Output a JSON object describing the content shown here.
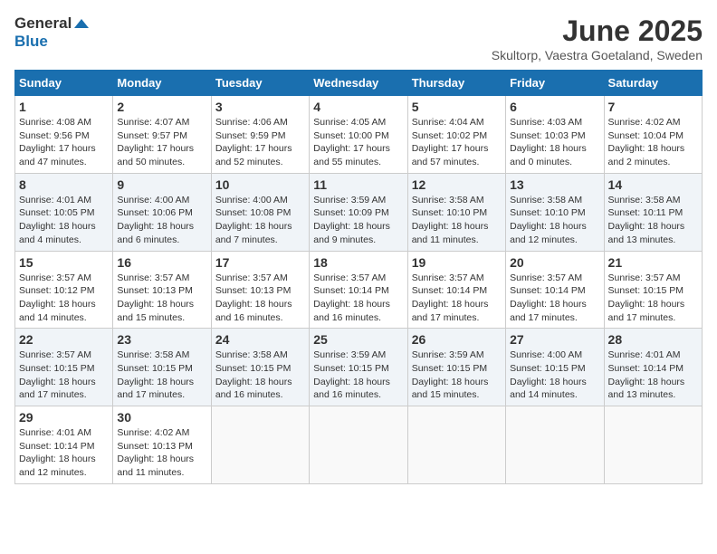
{
  "header": {
    "logo_general": "General",
    "logo_blue": "Blue",
    "month": "June 2025",
    "location": "Skultorp, Vaestra Goetaland, Sweden"
  },
  "weekdays": [
    "Sunday",
    "Monday",
    "Tuesday",
    "Wednesday",
    "Thursday",
    "Friday",
    "Saturday"
  ],
  "weeks": [
    [
      {
        "day": "1",
        "sunrise": "Sunrise: 4:08 AM",
        "sunset": "Sunset: 9:56 PM",
        "daylight": "Daylight: 17 hours and 47 minutes."
      },
      {
        "day": "2",
        "sunrise": "Sunrise: 4:07 AM",
        "sunset": "Sunset: 9:57 PM",
        "daylight": "Daylight: 17 hours and 50 minutes."
      },
      {
        "day": "3",
        "sunrise": "Sunrise: 4:06 AM",
        "sunset": "Sunset: 9:59 PM",
        "daylight": "Daylight: 17 hours and 52 minutes."
      },
      {
        "day": "4",
        "sunrise": "Sunrise: 4:05 AM",
        "sunset": "Sunset: 10:00 PM",
        "daylight": "Daylight: 17 hours and 55 minutes."
      },
      {
        "day": "5",
        "sunrise": "Sunrise: 4:04 AM",
        "sunset": "Sunset: 10:02 PM",
        "daylight": "Daylight: 17 hours and 57 minutes."
      },
      {
        "day": "6",
        "sunrise": "Sunrise: 4:03 AM",
        "sunset": "Sunset: 10:03 PM",
        "daylight": "Daylight: 18 hours and 0 minutes."
      },
      {
        "day": "7",
        "sunrise": "Sunrise: 4:02 AM",
        "sunset": "Sunset: 10:04 PM",
        "daylight": "Daylight: 18 hours and 2 minutes."
      }
    ],
    [
      {
        "day": "8",
        "sunrise": "Sunrise: 4:01 AM",
        "sunset": "Sunset: 10:05 PM",
        "daylight": "Daylight: 18 hours and 4 minutes."
      },
      {
        "day": "9",
        "sunrise": "Sunrise: 4:00 AM",
        "sunset": "Sunset: 10:06 PM",
        "daylight": "Daylight: 18 hours and 6 minutes."
      },
      {
        "day": "10",
        "sunrise": "Sunrise: 4:00 AM",
        "sunset": "Sunset: 10:08 PM",
        "daylight": "Daylight: 18 hours and 7 minutes."
      },
      {
        "day": "11",
        "sunrise": "Sunrise: 3:59 AM",
        "sunset": "Sunset: 10:09 PM",
        "daylight": "Daylight: 18 hours and 9 minutes."
      },
      {
        "day": "12",
        "sunrise": "Sunrise: 3:58 AM",
        "sunset": "Sunset: 10:10 PM",
        "daylight": "Daylight: 18 hours and 11 minutes."
      },
      {
        "day": "13",
        "sunrise": "Sunrise: 3:58 AM",
        "sunset": "Sunset: 10:10 PM",
        "daylight": "Daylight: 18 hours and 12 minutes."
      },
      {
        "day": "14",
        "sunrise": "Sunrise: 3:58 AM",
        "sunset": "Sunset: 10:11 PM",
        "daylight": "Daylight: 18 hours and 13 minutes."
      }
    ],
    [
      {
        "day": "15",
        "sunrise": "Sunrise: 3:57 AM",
        "sunset": "Sunset: 10:12 PM",
        "daylight": "Daylight: 18 hours and 14 minutes."
      },
      {
        "day": "16",
        "sunrise": "Sunrise: 3:57 AM",
        "sunset": "Sunset: 10:13 PM",
        "daylight": "Daylight: 18 hours and 15 minutes."
      },
      {
        "day": "17",
        "sunrise": "Sunrise: 3:57 AM",
        "sunset": "Sunset: 10:13 PM",
        "daylight": "Daylight: 18 hours and 16 minutes."
      },
      {
        "day": "18",
        "sunrise": "Sunrise: 3:57 AM",
        "sunset": "Sunset: 10:14 PM",
        "daylight": "Daylight: 18 hours and 16 minutes."
      },
      {
        "day": "19",
        "sunrise": "Sunrise: 3:57 AM",
        "sunset": "Sunset: 10:14 PM",
        "daylight": "Daylight: 18 hours and 17 minutes."
      },
      {
        "day": "20",
        "sunrise": "Sunrise: 3:57 AM",
        "sunset": "Sunset: 10:14 PM",
        "daylight": "Daylight: 18 hours and 17 minutes."
      },
      {
        "day": "21",
        "sunrise": "Sunrise: 3:57 AM",
        "sunset": "Sunset: 10:15 PM",
        "daylight": "Daylight: 18 hours and 17 minutes."
      }
    ],
    [
      {
        "day": "22",
        "sunrise": "Sunrise: 3:57 AM",
        "sunset": "Sunset: 10:15 PM",
        "daylight": "Daylight: 18 hours and 17 minutes."
      },
      {
        "day": "23",
        "sunrise": "Sunrise: 3:58 AM",
        "sunset": "Sunset: 10:15 PM",
        "daylight": "Daylight: 18 hours and 17 minutes."
      },
      {
        "day": "24",
        "sunrise": "Sunrise: 3:58 AM",
        "sunset": "Sunset: 10:15 PM",
        "daylight": "Daylight: 18 hours and 16 minutes."
      },
      {
        "day": "25",
        "sunrise": "Sunrise: 3:59 AM",
        "sunset": "Sunset: 10:15 PM",
        "daylight": "Daylight: 18 hours and 16 minutes."
      },
      {
        "day": "26",
        "sunrise": "Sunrise: 3:59 AM",
        "sunset": "Sunset: 10:15 PM",
        "daylight": "Daylight: 18 hours and 15 minutes."
      },
      {
        "day": "27",
        "sunrise": "Sunrise: 4:00 AM",
        "sunset": "Sunset: 10:15 PM",
        "daylight": "Daylight: 18 hours and 14 minutes."
      },
      {
        "day": "28",
        "sunrise": "Sunrise: 4:01 AM",
        "sunset": "Sunset: 10:14 PM",
        "daylight": "Daylight: 18 hours and 13 minutes."
      }
    ],
    [
      {
        "day": "29",
        "sunrise": "Sunrise: 4:01 AM",
        "sunset": "Sunset: 10:14 PM",
        "daylight": "Daylight: 18 hours and 12 minutes."
      },
      {
        "day": "30",
        "sunrise": "Sunrise: 4:02 AM",
        "sunset": "Sunset: 10:13 PM",
        "daylight": "Daylight: 18 hours and 11 minutes."
      },
      null,
      null,
      null,
      null,
      null
    ]
  ]
}
